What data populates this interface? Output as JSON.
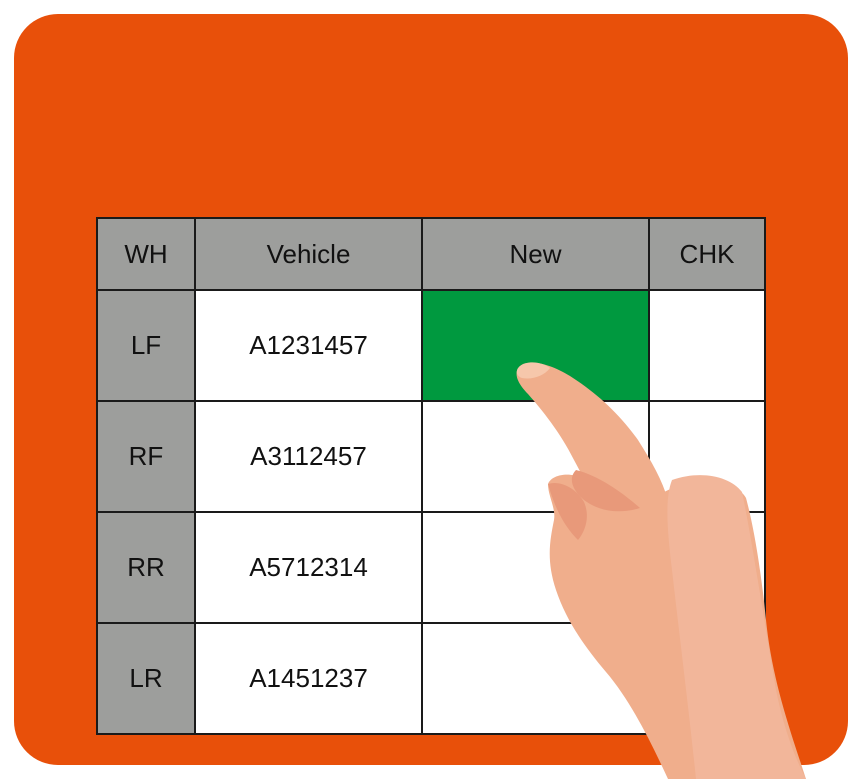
{
  "table": {
    "headers": [
      "WH",
      "Vehicle",
      "New",
      "CHK"
    ],
    "rows": [
      {
        "wh": "LF",
        "vehicle": "A1231457"
      },
      {
        "wh": "RF",
        "vehicle": "A3112457"
      },
      {
        "wh": "RR",
        "vehicle": "A5712314"
      },
      {
        "wh": "LR",
        "vehicle": "A1451237"
      }
    ],
    "selected_cell": {
      "row": 1,
      "column": "New"
    }
  },
  "colors": {
    "background_panel": "#e8500a",
    "header_fill": "#9d9e9c",
    "selected_fill": "#00993f",
    "hand_skin": "#f0ae8c"
  },
  "icons": {
    "pointer": "pointing-hand-icon"
  }
}
